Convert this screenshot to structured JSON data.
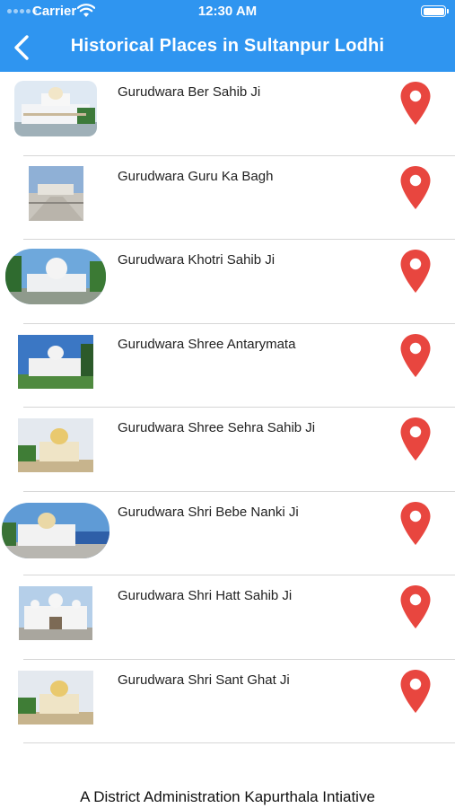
{
  "status_bar": {
    "carrier": "Carrier",
    "time": "12:30 AM"
  },
  "header": {
    "title": "Historical Places in Sultanpur Lodhi",
    "back_icon": "chevron-left-icon"
  },
  "colors": {
    "header_bg": "#2f95f0",
    "pin": "#e8463f",
    "separator": "#d6d6d6"
  },
  "places": [
    {
      "name": "Gurudwara Ber Sahib Ji"
    },
    {
      "name": "Gurudwara Guru Ka Bagh"
    },
    {
      "name": "Gurudwara Khotri Sahib Ji"
    },
    {
      "name": "Gurudwara Shree Antarymata"
    },
    {
      "name": "Gurudwara Shree Sehra Sahib Ji"
    },
    {
      "name": "Gurudwara Shri Bebe Nanki Ji"
    },
    {
      "name": "Gurudwara Shri Hatt Sahib Ji"
    },
    {
      "name": "Gurudwara Shri Sant Ghat Ji"
    }
  ],
  "footer": {
    "text": "A District Administration Kapurthala Intiative"
  }
}
